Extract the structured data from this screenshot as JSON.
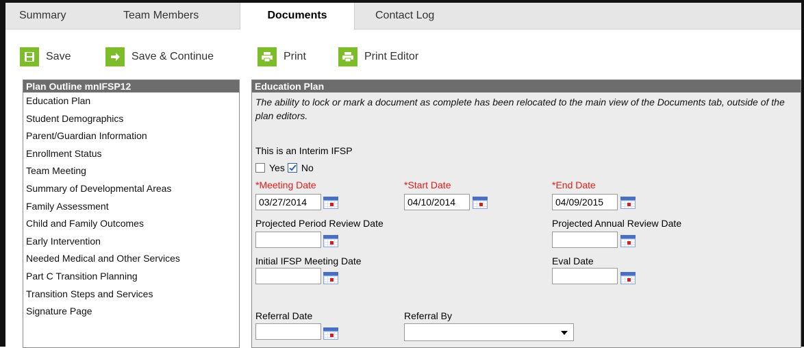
{
  "tabs": [
    {
      "label": "Summary"
    },
    {
      "label": "Team Members"
    },
    {
      "label": "Documents",
      "active": true
    },
    {
      "label": "Contact Log"
    }
  ],
  "toolbar": {
    "save": "Save",
    "save_continue": "Save & Continue",
    "print": "Print",
    "print_editor": "Print Editor"
  },
  "outline": {
    "title": "Plan Outline mnIFSP12",
    "items": [
      "Education Plan",
      "Student Demographics",
      "Parent/Guardian Information",
      "Enrollment Status",
      "Team Meeting",
      "Summary of Developmental Areas",
      "Family Assessment",
      "Child and Family Outcomes",
      "Early Intervention",
      "Needed Medical and Other Services",
      "Part C Transition Planning",
      "Transition Steps and Services",
      "Signature Page"
    ]
  },
  "editor": {
    "title": "Education Plan",
    "note": "The ability to lock or mark a document as complete has been relocated to the main view of the Documents tab, outside of the plan editors.",
    "interim_label": "This is an Interim IFSP",
    "yes_label": "Yes",
    "no_label": "No",
    "interim_yes": false,
    "interim_no": true,
    "meeting_date_label": "*Meeting Date",
    "meeting_date": "03/27/2014",
    "start_date_label": "*Start Date",
    "start_date": "04/10/2014",
    "end_date_label": "*End Date",
    "end_date": "04/09/2015",
    "projected_period_label": "Projected Period Review Date",
    "projected_period": "",
    "projected_annual_label": "Projected Annual Review Date",
    "projected_annual": "",
    "initial_meeting_label": "Initial IFSP Meeting Date",
    "initial_meeting": "",
    "eval_date_label": "Eval Date",
    "eval_date": "",
    "referral_date_label": "Referral Date",
    "referral_date": "",
    "referral_by_label": "Referral By",
    "referral_by": ""
  },
  "colors": {
    "accent_green": "#7dbd2a",
    "header_gray": "#6d6d6d",
    "required_red": "#e31b1b"
  }
}
